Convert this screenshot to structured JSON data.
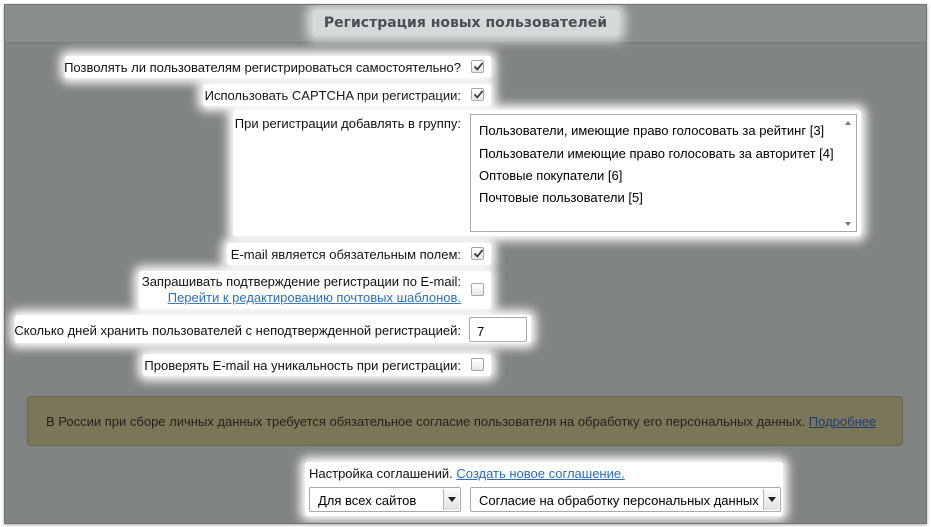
{
  "section": {
    "title": "Регистрация новых пользователей"
  },
  "fields": {
    "allow_self_register": {
      "label": "Позволять ли пользователям регистрироваться самостоятельно?",
      "checked": true
    },
    "use_captcha": {
      "label": "Использовать CAPTCHA при регистрации:",
      "checked": true
    },
    "add_to_group": {
      "label": "При регистрации добавлять в группу:",
      "options": [
        "Пользователи, имеющие право голосовать за рейтинг [3]",
        "Пользователи имеющие право голосовать за авторитет [4]",
        "Оптовые покупатели [6]",
        "Почтовые пользователи [5]"
      ]
    },
    "email_required": {
      "label": "E-mail является обязательным полем:",
      "checked": true
    },
    "email_confirm": {
      "label": "Запрашивать подтверждение регистрации по E-mail:",
      "link": "Перейти к редактированию почтовых шаблонов.",
      "checked": false
    },
    "keep_days": {
      "label": "Сколько дней хранить пользователей с неподтвержденной регистрацией:",
      "value": "7"
    },
    "email_unique": {
      "label": "Проверять E-mail на уникальность при регистрации:",
      "checked": false
    }
  },
  "notice": {
    "text": "В России при сборе личных данных требуется обязательное согласие пользователя на обработку его персональных данных. ",
    "link": "Подробнее"
  },
  "agreements": {
    "label": "Настройка соглашений.",
    "create_link": "Создать новое соглашение.",
    "site_select": "Для всех сайтов",
    "agreement_select": "Согласие на обработку персональных данных"
  },
  "colors": {
    "overlay": "#808483",
    "link": "#2a6fbf",
    "notice_bg": "#7c7658"
  }
}
